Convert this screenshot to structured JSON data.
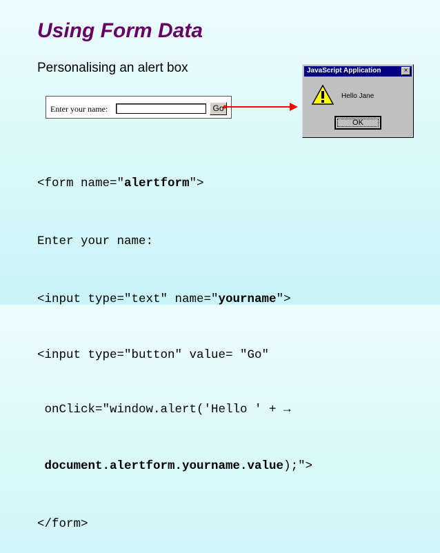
{
  "slide": {
    "title": "Using Form Data",
    "subtitle": "Personalising an alert box"
  },
  "mini_form": {
    "label": "Enter your name:",
    "input_value": "",
    "go_button": "Go"
  },
  "dialog": {
    "title": "JavaScript Application",
    "close": "×",
    "message": "Hello Jane",
    "ok_button": "OK",
    "icon": "warning-icon"
  },
  "code": {
    "l1_a": "<form name=\"",
    "l1_b": "alertform",
    "l1_c": "\">",
    "l2": "Enter your name:",
    "l3_a": "<input type=\"text\" name=\"",
    "l3_b": "yourname",
    "l3_c": "\">",
    "l4": "<input type=\"button\" value= \"Go\"",
    "l5": " onClick=\"window.alert('Hello ' + →",
    "l6_a": " document.alertform.yourname.value",
    "l6_b": ");\">",
    "l7": "</form>"
  },
  "colors": {
    "title": "#660066",
    "arrow": "#ff0000",
    "titlebar": "#000080"
  }
}
